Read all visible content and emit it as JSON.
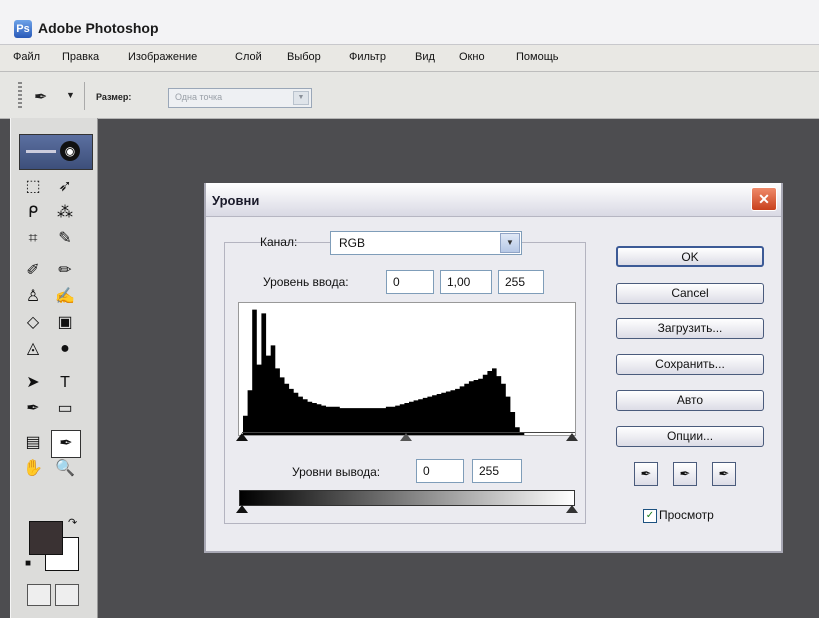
{
  "app": {
    "title": "Adobe Photoshop",
    "icon": "photoshop-app-icon"
  },
  "menu": [
    "Файл",
    "Правка",
    "Изображение",
    "Слой",
    "Выбор",
    "Фильтр",
    "Вид",
    "Окно",
    "Помощь"
  ],
  "options": {
    "size_label": "Размер:",
    "size_value": "Одна точка",
    "tool_icon": "eyedropper-icon"
  },
  "toolbox": {
    "foreground_color": "#3a3233",
    "background_color": "#ffffff"
  },
  "dialog": {
    "title": "Уровни",
    "channel_label": "Канал:",
    "channel_value": "RGB",
    "input_label": "Уровень ввода:",
    "input_values": {
      "black": "0",
      "gamma": "1,00",
      "white": "255"
    },
    "output_label": "Уровни вывода:",
    "output_values": {
      "black": "0",
      "white": "255"
    },
    "buttons": {
      "ok": "OK",
      "cancel": "Cancel",
      "load": "Загрузить...",
      "save": "Сохранить...",
      "auto": "Авто",
      "options": "Опции..."
    },
    "preview_label": "Просмотр",
    "preview_checked": true,
    "histogram": [
      0.15,
      0.35,
      0.98,
      0.55,
      0.95,
      0.62,
      0.7,
      0.52,
      0.45,
      0.4,
      0.36,
      0.33,
      0.3,
      0.28,
      0.26,
      0.25,
      0.24,
      0.23,
      0.22,
      0.22,
      0.22,
      0.21,
      0.21,
      0.21,
      0.21,
      0.21,
      0.21,
      0.21,
      0.21,
      0.21,
      0.21,
      0.22,
      0.22,
      0.23,
      0.24,
      0.25,
      0.26,
      0.27,
      0.28,
      0.29,
      0.3,
      0.31,
      0.32,
      0.33,
      0.34,
      0.35,
      0.36,
      0.38,
      0.4,
      0.42,
      0.43,
      0.44,
      0.47,
      0.5,
      0.52,
      0.46,
      0.4,
      0.3,
      0.18,
      0.06,
      0.02,
      0.0,
      0.0,
      0.0,
      0.0,
      0.0,
      0.0,
      0.0,
      0.0,
      0.0,
      0.0,
      0.0
    ]
  }
}
